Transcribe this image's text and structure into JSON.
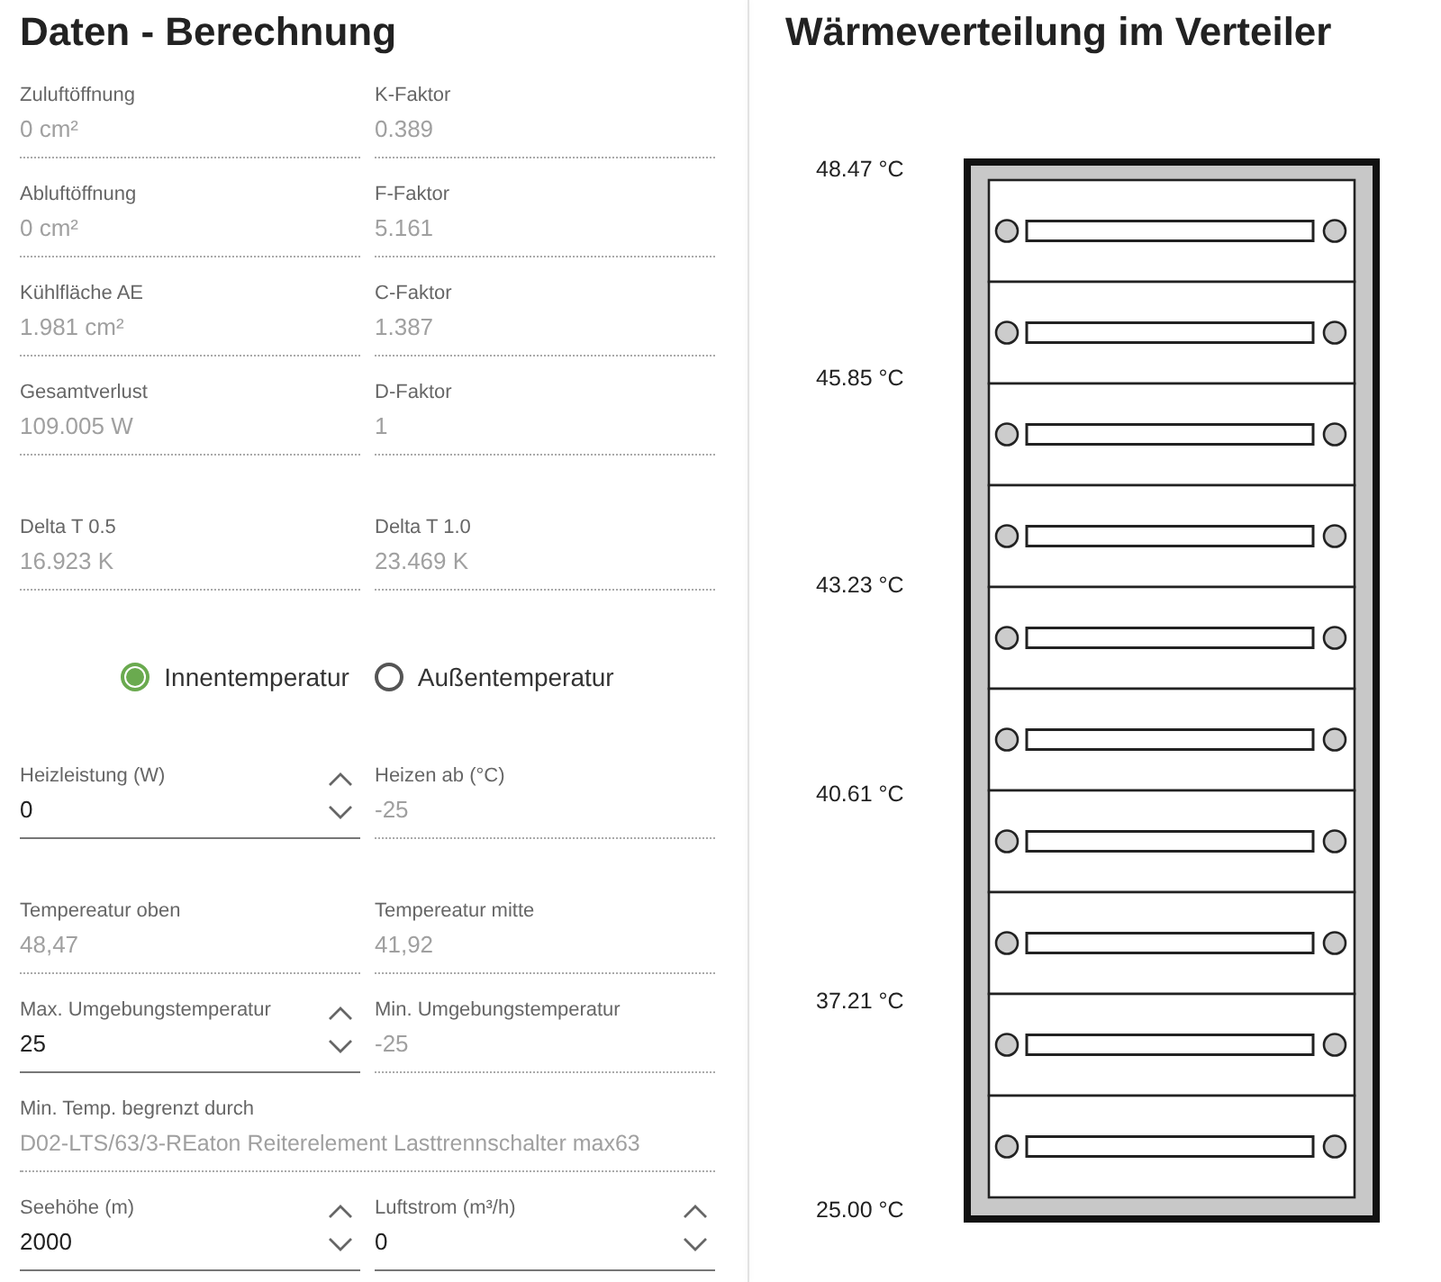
{
  "calculation": {
    "title": "Daten - Berechnung",
    "blocks": [
      {
        "kind": "fields",
        "rows": [
          [
            {
              "label": "Zuluftöffnung",
              "value": "0 cm²",
              "kind": "readonly"
            },
            {
              "label": "K-Faktor",
              "value": "0.389",
              "kind": "readonly"
            }
          ],
          [
            {
              "label": "Abluftöffnung",
              "value": "0 cm²",
              "kind": "readonly"
            },
            {
              "label": "F-Faktor",
              "value": "5.161",
              "kind": "readonly"
            }
          ],
          [
            {
              "label": "Kühlfläche AE",
              "value": "1.981 cm²",
              "kind": "readonly"
            },
            {
              "label": "C-Faktor",
              "value": "1.387",
              "kind": "readonly"
            }
          ],
          [
            {
              "label": "Gesamtverlust",
              "value": "109.005 W",
              "kind": "readonly"
            },
            {
              "label": "D-Faktor",
              "value": "1",
              "kind": "readonly"
            }
          ]
        ]
      },
      {
        "kind": "fields",
        "rows": [
          [
            {
              "label": "Delta T 0.5",
              "value": "16.923 K",
              "kind": "readonly"
            },
            {
              "label": "Delta T 1.0",
              "value": "23.469 K",
              "kind": "readonly"
            }
          ]
        ]
      },
      {
        "kind": "radio",
        "options": [
          {
            "label": "Innentemperatur",
            "selected": true
          },
          {
            "label": "Außentemperatur",
            "selected": false
          }
        ]
      },
      {
        "kind": "fields",
        "rows": [
          [
            {
              "label": "Heizleistung (W)",
              "value": "0",
              "kind": "spinner"
            },
            {
              "label": "Heizen ab (°C)",
              "value": "-25",
              "kind": "readonly"
            }
          ]
        ]
      },
      {
        "kind": "fields",
        "rows": [
          [
            {
              "label": "Tempereatur oben",
              "value": "48,47",
              "kind": "readonly"
            },
            {
              "label": "Tempereatur mitte",
              "value": "41,92",
              "kind": "readonly"
            }
          ],
          [
            {
              "label": "Max. Umgebungstemperatur",
              "value": "25",
              "kind": "spinner"
            },
            {
              "label": "Min. Umgebungstemperatur",
              "value": "-25",
              "kind": "readonly"
            }
          ],
          [
            {
              "label": "Min. Temp. begrenzt durch",
              "value": "D02-LTS/63/3-REaton Reiterelement Lasttrennschalter max63",
              "kind": "readonly"
            }
          ],
          [
            {
              "label": "Seehöhe (m)",
              "value": "2000",
              "kind": "spinner"
            },
            {
              "label": "Luftstrom (m³/h)",
              "value": "0",
              "kind": "spinner"
            }
          ]
        ]
      }
    ]
  },
  "heat_distribution": {
    "title": "Wärmeverteilung im Verteiler",
    "scale_labels": [
      "48.47 °C",
      "45.85 °C",
      "43.23 °C",
      "40.61 °C",
      "37.21 °C",
      "25.00 °C"
    ]
  }
}
